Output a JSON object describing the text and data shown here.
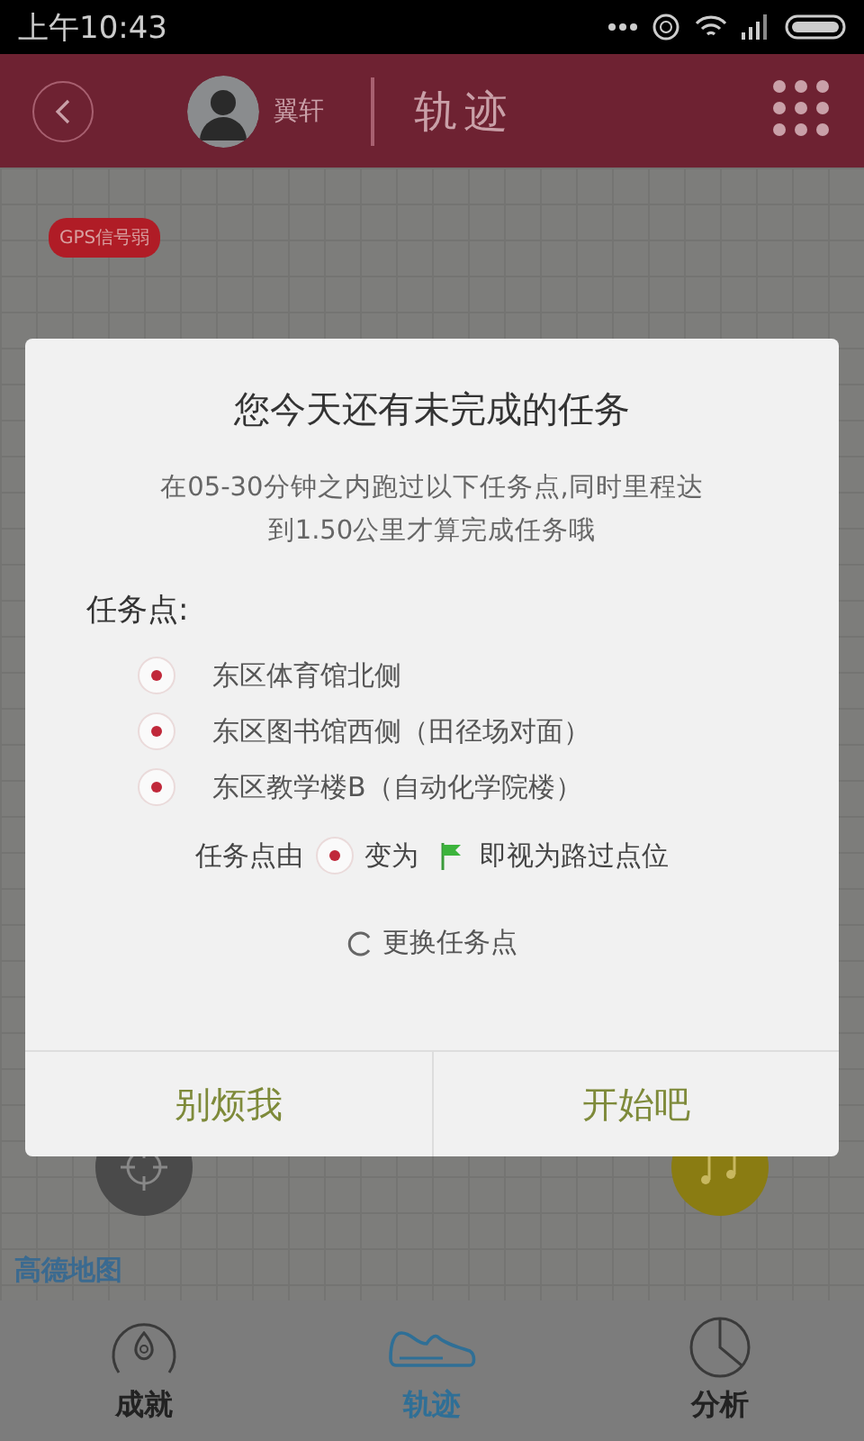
{
  "status_bar": {
    "time": "上午10:43"
  },
  "header": {
    "user_name": "翼轩",
    "title": "轨迹"
  },
  "map": {
    "gps_badge": "GPS信号弱",
    "logo": "高德地图"
  },
  "dialog": {
    "title": "您今天还有未完成的任务",
    "description": "在05-30分钟之内跑过以下任务点,同时里程达到1.50公里才算完成任务哦",
    "points_label": "任务点:",
    "points": [
      {
        "name": "东区体育馆北侧",
        "passed": false
      },
      {
        "name": "东区图书馆西侧（田径场对面）",
        "passed": false
      },
      {
        "name": "东区教学楼B（自动化学院楼）",
        "passed": false
      }
    ],
    "hint": [
      "任务点由",
      "变为",
      "即视为路过点位"
    ],
    "refresh": "更换任务点",
    "buttons": [
      "别烦我",
      "开始吧"
    ]
  },
  "tabs": [
    {
      "label": "成就",
      "kind": "medal",
      "selected": false
    },
    {
      "label": "轨迹",
      "kind": "shoe",
      "selected": true
    },
    {
      "label": "分析",
      "kind": "pie",
      "selected": false
    }
  ]
}
